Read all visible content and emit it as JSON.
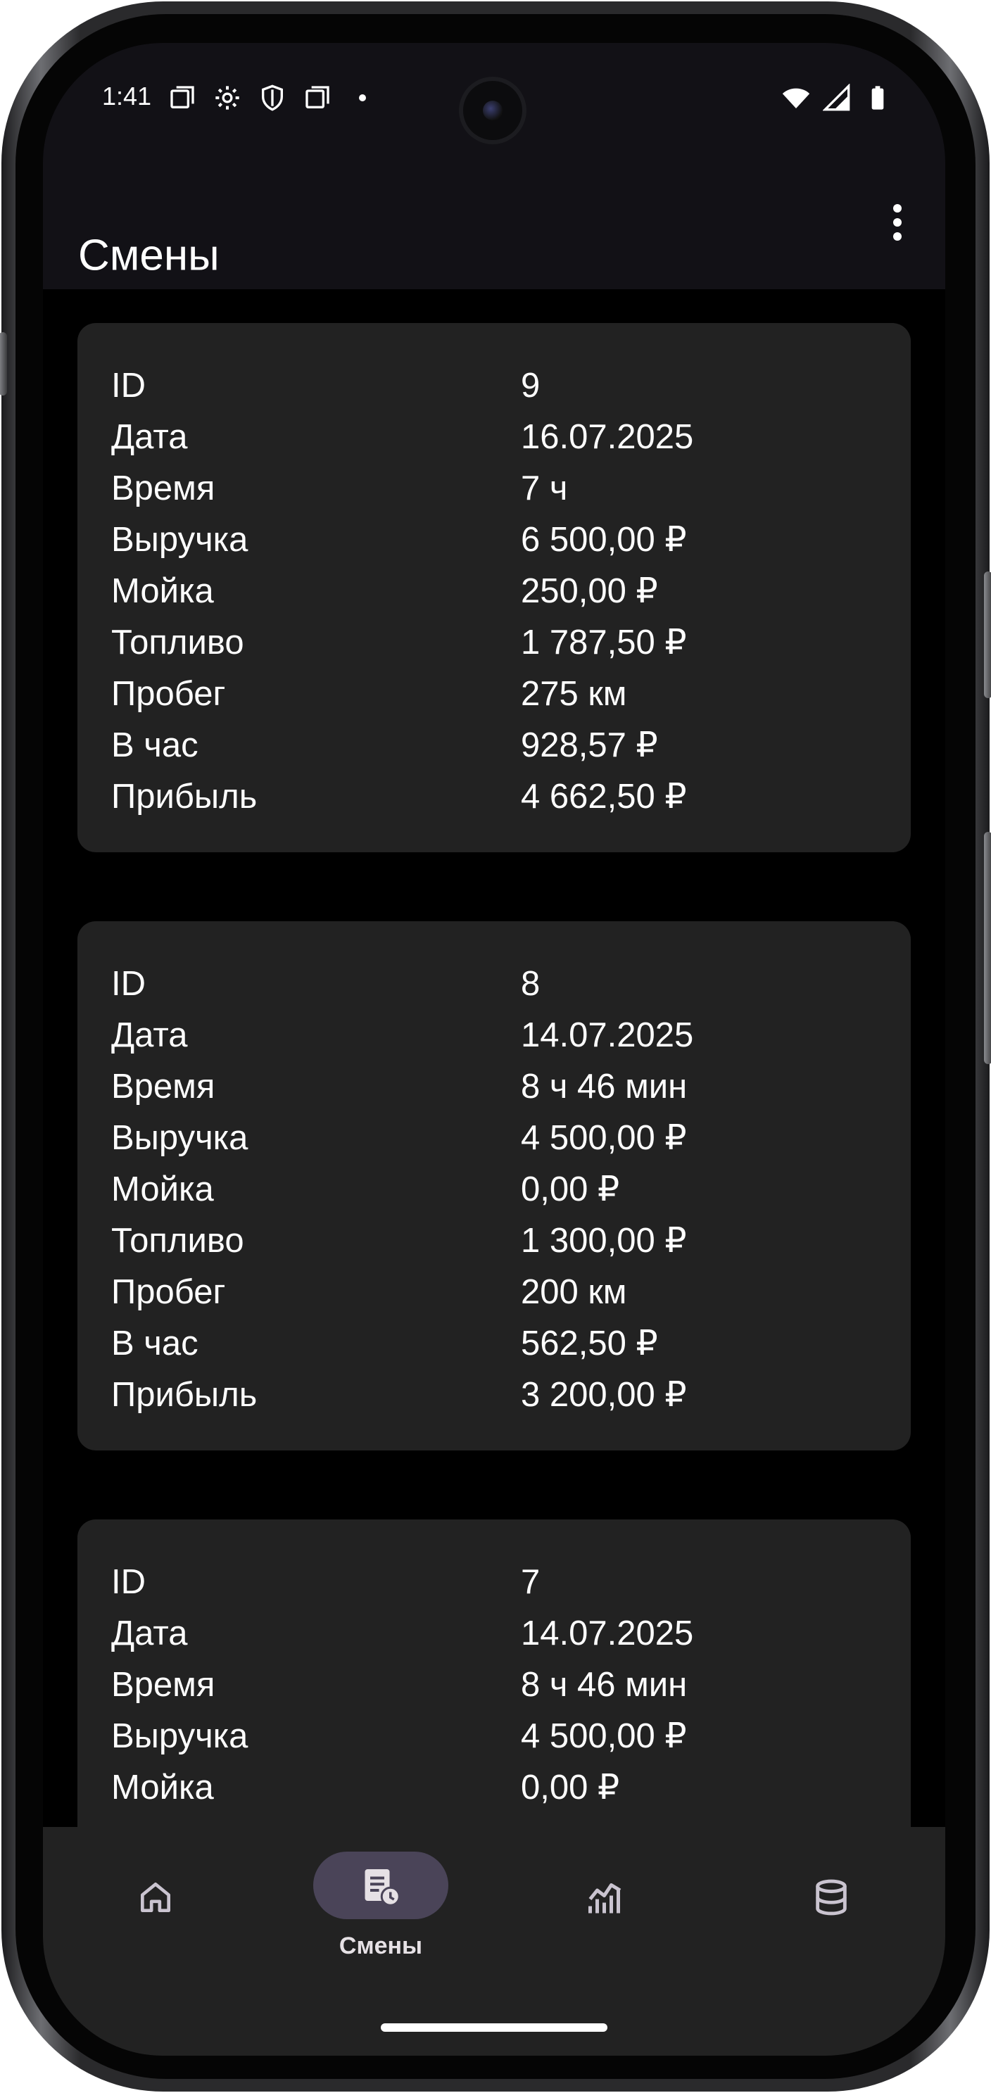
{
  "status_bar": {
    "time": "1:41",
    "left_icons": [
      "screenshot-icon",
      "settings-icon",
      "shield-icon",
      "screenshot-icon",
      "dot-icon"
    ],
    "right_icons": [
      "wifi-icon",
      "signal-icon",
      "battery-icon"
    ]
  },
  "app_bar": {
    "title": "Смены",
    "menu_icon": "more-vert-icon"
  },
  "shifts": [
    {
      "rows": [
        {
          "label": "ID",
          "value": "9"
        },
        {
          "label": "Дата",
          "value": "16.07.2025"
        },
        {
          "label": "Время",
          "value": "7 ч"
        },
        {
          "label": "Выручка",
          "value": "6 500,00 ₽"
        },
        {
          "label": "Мойка",
          "value": "250,00 ₽"
        },
        {
          "label": "Топливо",
          "value": "1 787,50 ₽"
        },
        {
          "label": "Пробег",
          "value": "275 км"
        },
        {
          "label": "В час",
          "value": "928,57 ₽"
        },
        {
          "label": "Прибыль",
          "value": "4 662,50 ₽"
        }
      ]
    },
    {
      "rows": [
        {
          "label": "ID",
          "value": "8"
        },
        {
          "label": "Дата",
          "value": "14.07.2025"
        },
        {
          "label": "Время",
          "value": "8 ч 46 мин"
        },
        {
          "label": "Выручка",
          "value": "4 500,00 ₽"
        },
        {
          "label": "Мойка",
          "value": "0,00 ₽"
        },
        {
          "label": "Топливо",
          "value": "1 300,00 ₽"
        },
        {
          "label": "Пробег",
          "value": "200 км"
        },
        {
          "label": "В час",
          "value": "562,50 ₽"
        },
        {
          "label": "Прибыль",
          "value": "3 200,00 ₽"
        }
      ]
    },
    {
      "rows": [
        {
          "label": "ID",
          "value": "7"
        },
        {
          "label": "Дата",
          "value": "14.07.2025"
        },
        {
          "label": "Время",
          "value": "8 ч 46 мин"
        },
        {
          "label": "Выручка",
          "value": "4 500,00 ₽"
        },
        {
          "label": "Мойка",
          "value": "0,00 ₽"
        }
      ]
    }
  ],
  "bottom_nav": {
    "items": [
      {
        "icon": "home-icon",
        "label": "",
        "selected": false
      },
      {
        "icon": "shifts-icon",
        "label": "Смены",
        "selected": true
      },
      {
        "icon": "statistics-icon",
        "label": "",
        "selected": false
      },
      {
        "icon": "database-icon",
        "label": "",
        "selected": false
      }
    ]
  },
  "colors": {
    "background": "#000000",
    "surface": "#222222",
    "bar": "#121116",
    "selected_pill": "#4a4458",
    "text": "#ffffff"
  }
}
